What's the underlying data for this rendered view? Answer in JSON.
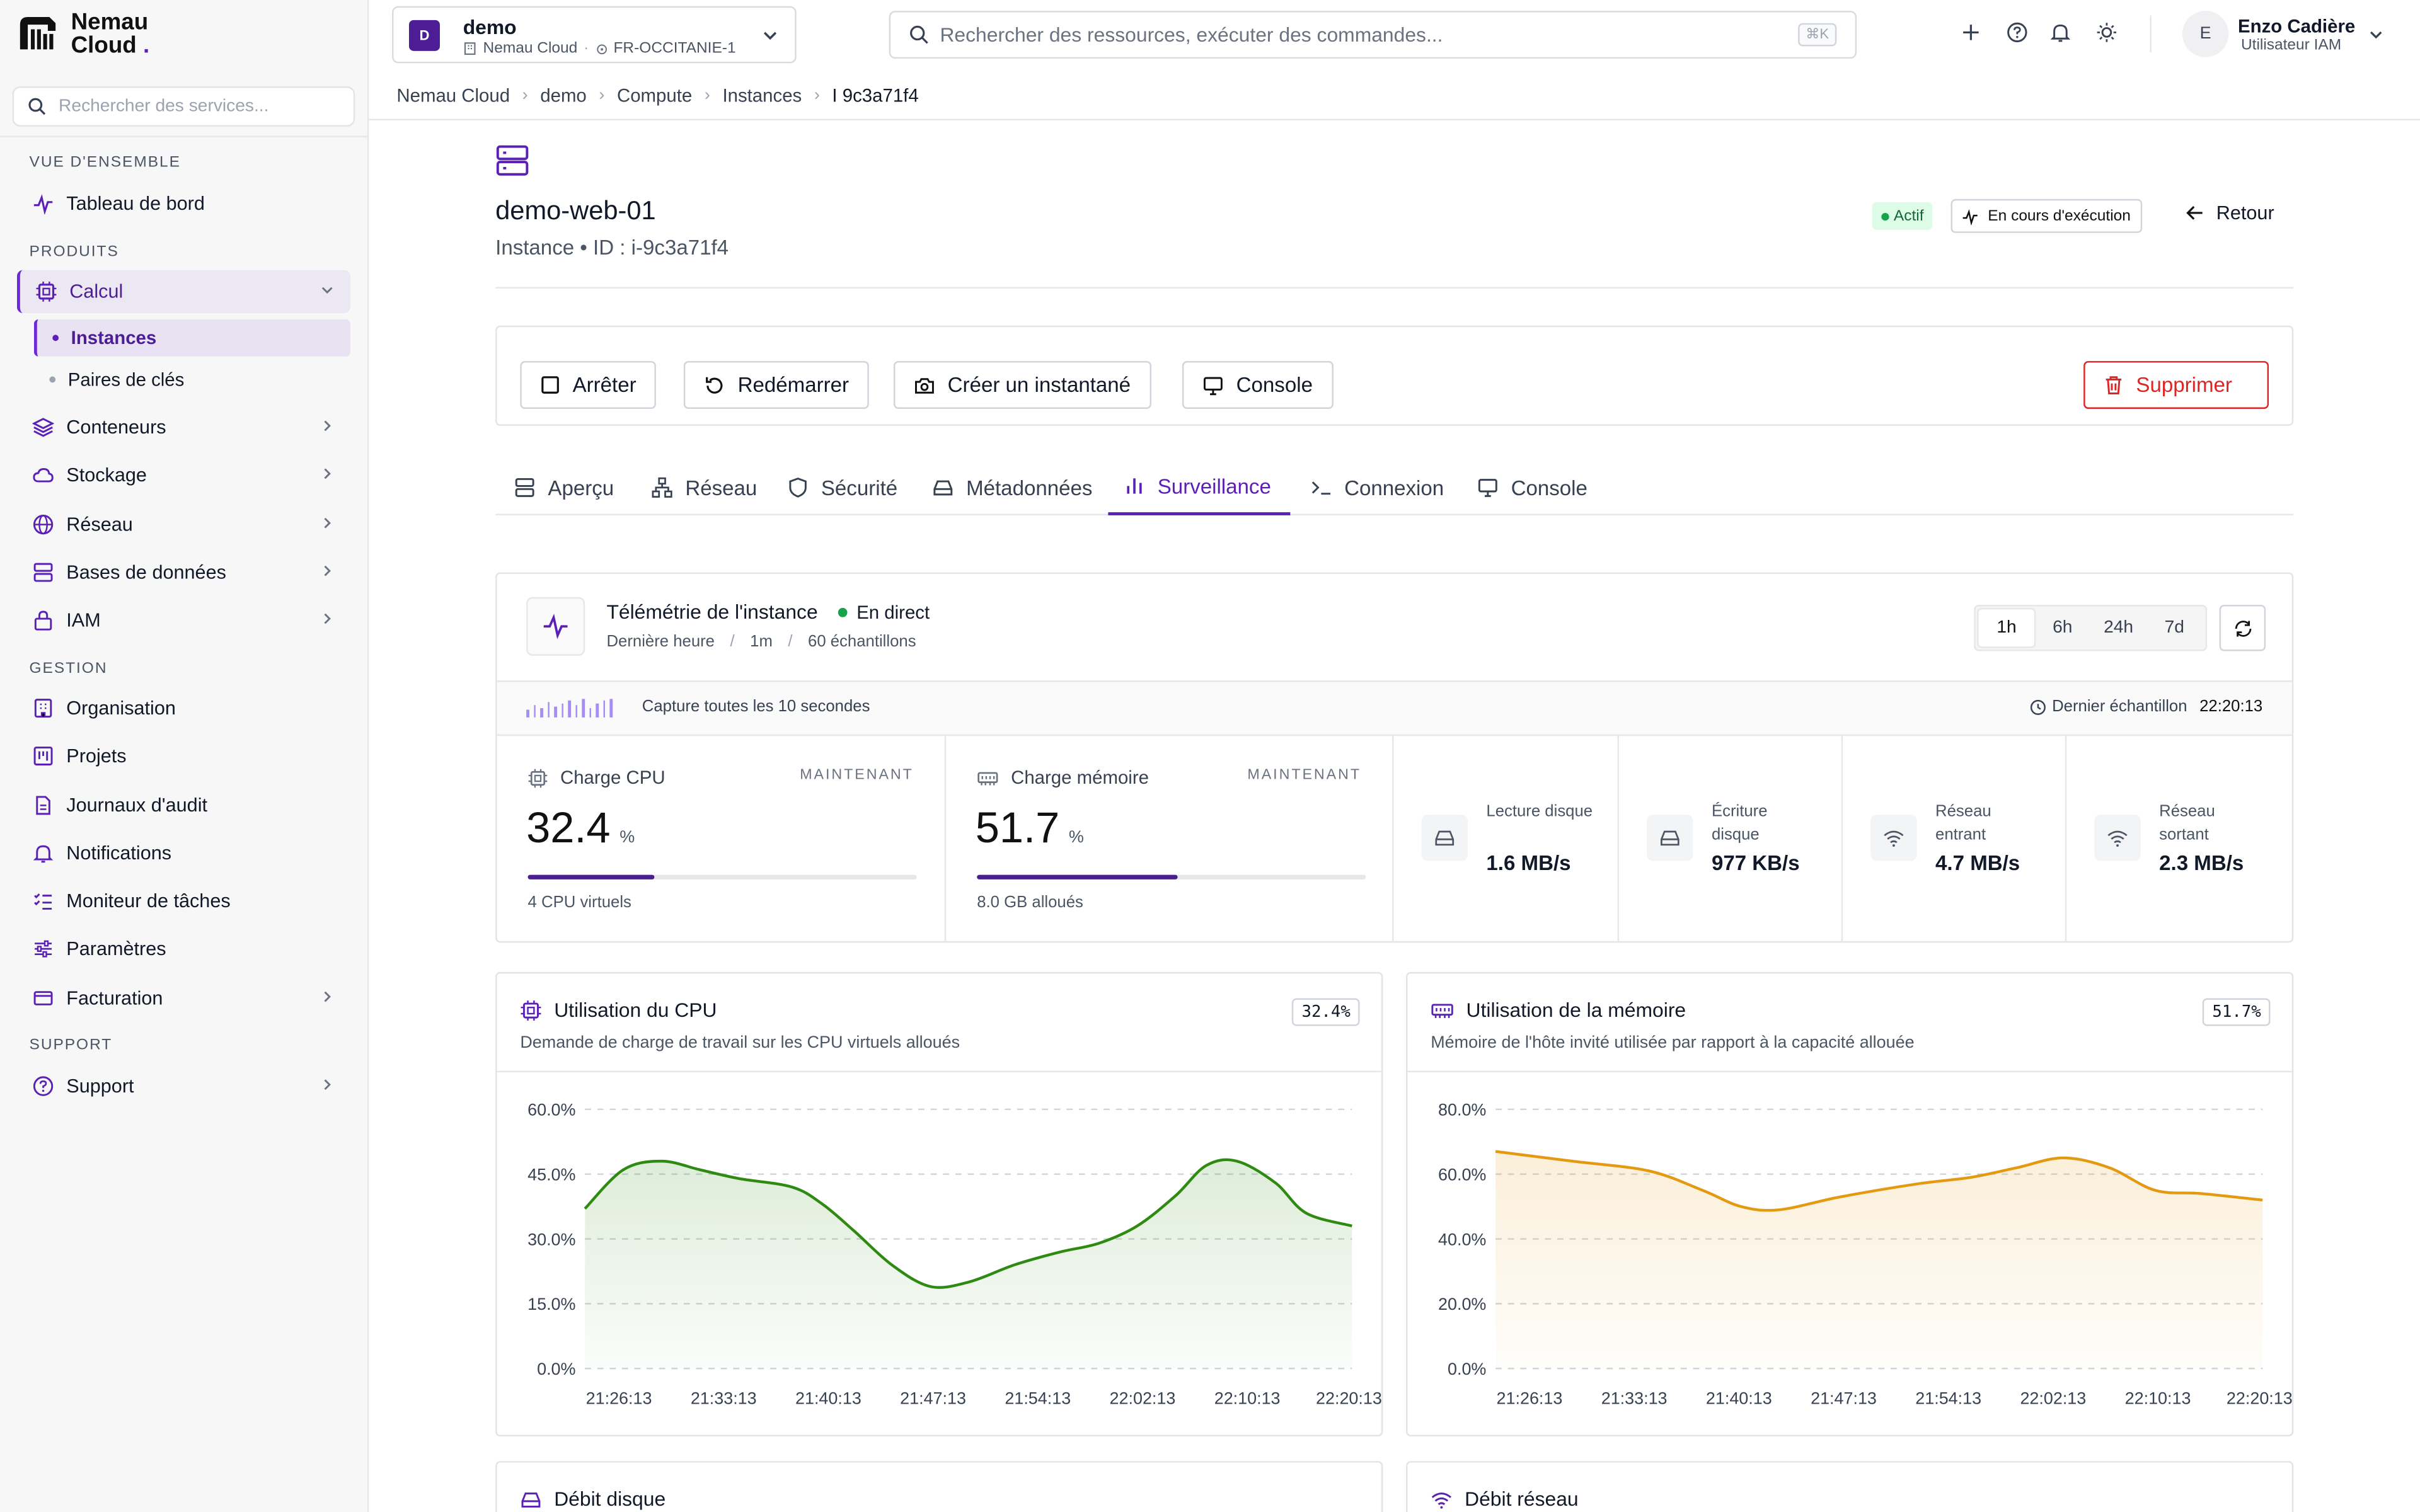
{
  "brand": {
    "line1": "Nemau",
    "line2": "Cloud",
    "dot": "."
  },
  "sidebar": {
    "search_placeholder": "Rechercher des services...",
    "sections": {
      "overview": "VUE D'ENSEMBLE",
      "products": "PRODUITS",
      "management": "GESTION",
      "support": "SUPPORT"
    },
    "items": {
      "dashboard": "Tableau de bord",
      "compute": "Calcul",
      "instances": "Instances",
      "keypairs": "Paires de clés",
      "containers": "Conteneurs",
      "storage": "Stockage",
      "network": "Réseau",
      "databases": "Bases de données",
      "iam": "IAM",
      "organization": "Organisation",
      "projects": "Projets",
      "audit": "Journaux d'audit",
      "notifications": "Notifications",
      "tasks": "Moniteur de tâches",
      "settings": "Paramètres",
      "billing": "Facturation",
      "support": "Support"
    }
  },
  "topbar": {
    "project": {
      "initial": "D",
      "name": "demo",
      "org": "Nemau Cloud",
      "region": "FR-OCCITANIE-1"
    },
    "search_placeholder": "Rechercher des ressources, exécuter des commandes...",
    "shortcut": "⌘K",
    "user": {
      "initial": "E",
      "name": "Enzo Cadière",
      "role": "Utilisateur IAM"
    }
  },
  "breadcrumb": [
    "Nemau Cloud",
    "demo",
    "Compute",
    "Instances",
    "I 9c3a71f4"
  ],
  "instance": {
    "name": "demo-web-01",
    "subtitle": "Instance • ID : i-9c3a71f4",
    "status": "Actif",
    "state": "En cours d'exécution",
    "back": "Retour"
  },
  "actions": {
    "stop": "Arrêter",
    "restart": "Redémarrer",
    "snapshot": "Créer un instantané",
    "console": "Console",
    "delete": "Supprimer"
  },
  "tabs": [
    "Aperçu",
    "Réseau",
    "Sécurité",
    "Métadonnées",
    "Surveillance",
    "Connexion",
    "Console"
  ],
  "active_tab": "Surveillance",
  "telemetry": {
    "title": "Télémétrie de l'instance",
    "live": "En direct",
    "window": "Dernière heure",
    "step": "1m",
    "samples": "60 échantillons",
    "ranges": [
      "1h",
      "6h",
      "24h",
      "7d"
    ],
    "active_range": "1h",
    "capture": "Capture toutes les 10 secondes",
    "last_sample_label": "Dernier échantillon",
    "last_sample": "22:20:13",
    "now_label": "MAINTENANT",
    "cpu": {
      "label": "Charge CPU",
      "value": "32.4",
      "unit": "%",
      "fraction": 0.324,
      "footer": "4 CPU virtuels"
    },
    "mem": {
      "label": "Charge mémoire",
      "value": "51.7",
      "unit": "%",
      "fraction": 0.517,
      "footer": "8.0 GB alloués"
    },
    "stats": [
      {
        "label": "Lecture disque",
        "value": "1.6 MB/s",
        "icon": "disk-icon"
      },
      {
        "label": "Écriture disque",
        "value": "977 KB/s",
        "icon": "disk-icon"
      },
      {
        "label": "Réseau entrant",
        "value": "4.7 MB/s",
        "icon": "wifi-icon"
      },
      {
        "label": "Réseau sortant",
        "value": "2.3 MB/s",
        "icon": "wifi-icon"
      }
    ]
  },
  "charts": {
    "cpu": {
      "title": "Utilisation du CPU",
      "subtitle": "Demande de charge de travail sur les CPU virtuels alloués",
      "badge": "32.4%"
    },
    "mem": {
      "title": "Utilisation de la mémoire",
      "subtitle": "Mémoire de l'hôte invité utilisée par rapport à la capacité allouée",
      "badge": "51.7%"
    },
    "disk": {
      "title": "Débit disque"
    },
    "net": {
      "title": "Débit réseau"
    }
  },
  "colors": {
    "accent": "#5b21b6",
    "cpu_line": "#2f8a12",
    "mem_line": "#e39a10",
    "status_green": "#16a34a",
    "danger": "#dc2626"
  },
  "chart_data": [
    {
      "type": "area",
      "title": "Utilisation du CPU",
      "x": [
        "21:26:13",
        "21:33:13",
        "21:40:13",
        "21:47:13",
        "21:54:13",
        "22:02:13",
        "22:10:13",
        "22:20:13"
      ],
      "ylim": [
        0,
        60
      ],
      "yticks": [
        "0.0%",
        "15.0%",
        "30.0%",
        "45.0%",
        "60.0%"
      ],
      "points": [
        [
          0,
          37
        ],
        [
          0.05,
          46
        ],
        [
          0.1,
          48
        ],
        [
          0.15,
          46
        ],
        [
          0.2,
          44
        ],
        [
          0.27,
          42
        ],
        [
          0.31,
          38
        ],
        [
          0.35,
          32
        ],
        [
          0.4,
          24
        ],
        [
          0.45,
          19
        ],
        [
          0.5,
          20
        ],
        [
          0.56,
          24
        ],
        [
          0.62,
          27
        ],
        [
          0.67,
          29
        ],
        [
          0.72,
          33
        ],
        [
          0.77,
          40
        ],
        [
          0.81,
          47
        ],
        [
          0.85,
          48
        ],
        [
          0.9,
          43
        ],
        [
          0.94,
          36
        ],
        [
          1,
          33
        ]
      ]
    },
    {
      "type": "area",
      "title": "Utilisation de la mémoire",
      "x": [
        "21:26:13",
        "21:33:13",
        "21:40:13",
        "21:47:13",
        "21:54:13",
        "22:02:13",
        "22:10:13",
        "22:20:13"
      ],
      "ylim": [
        0,
        80
      ],
      "yticks": [
        "0.0%",
        "20.0%",
        "40.0%",
        "60.0%",
        "80.0%"
      ],
      "points": [
        [
          0,
          67
        ],
        [
          0.1,
          64
        ],
        [
          0.2,
          61
        ],
        [
          0.27,
          55
        ],
        [
          0.32,
          50
        ],
        [
          0.37,
          49
        ],
        [
          0.45,
          53
        ],
        [
          0.55,
          57
        ],
        [
          0.62,
          59
        ],
        [
          0.68,
          62
        ],
        [
          0.74,
          65
        ],
        [
          0.8,
          62
        ],
        [
          0.86,
          55
        ],
        [
          0.92,
          54
        ],
        [
          1,
          52
        ]
      ]
    }
  ]
}
